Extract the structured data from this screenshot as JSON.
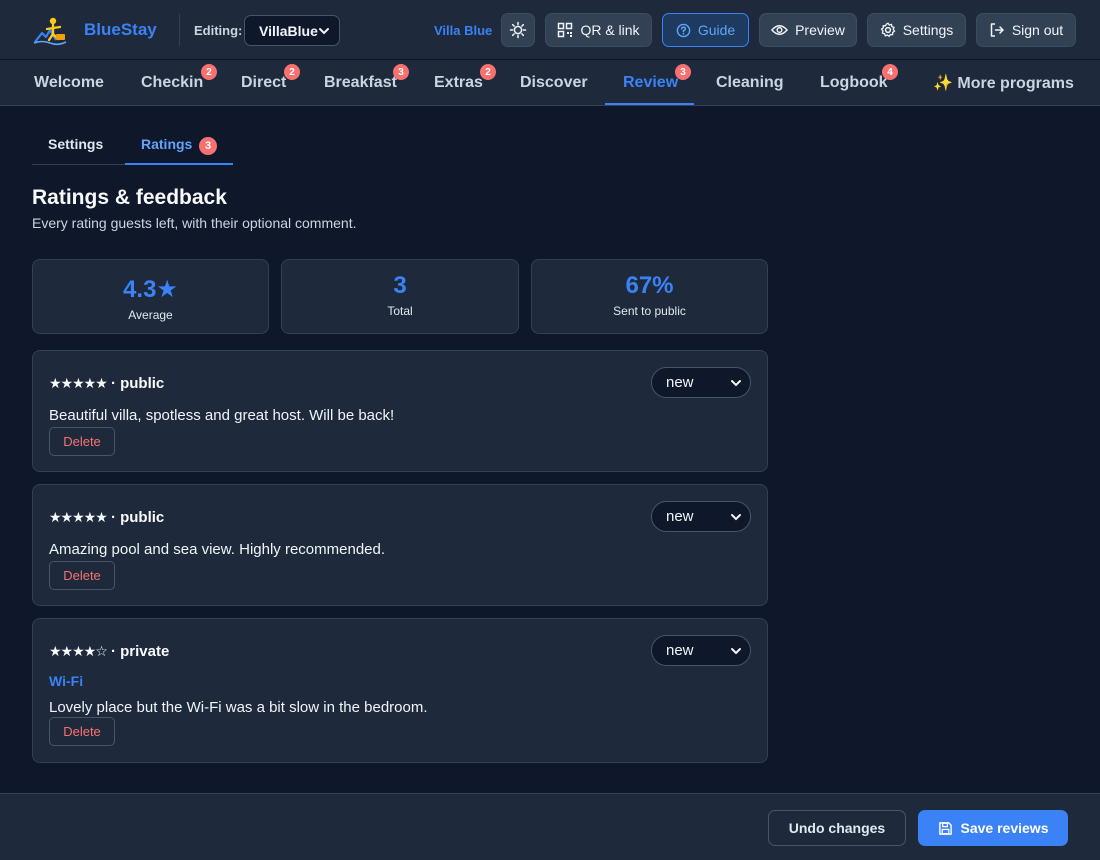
{
  "header": {
    "brand": "BlueStay",
    "editing_label": "Editing:",
    "editing_value": "VillaBlue",
    "villa_name": "Villa Blue",
    "buttons": {
      "qr": "QR & link",
      "guide": "Guide",
      "preview": "Preview",
      "settings": "Settings",
      "signout": "Sign out"
    },
    "icons": [
      "sun-icon",
      "qr-icon",
      "help-circle-icon",
      "eye-icon",
      "gear-icon",
      "logout-icon"
    ]
  },
  "nav": {
    "active": "Review",
    "tabs": [
      {
        "label": "Welcome",
        "badge": ""
      },
      {
        "label": "Checkin",
        "badge": "2"
      },
      {
        "label": "Direct",
        "badge": "2"
      },
      {
        "label": "Breakfast",
        "badge": "3"
      },
      {
        "label": "Extras",
        "badge": "2"
      },
      {
        "label": "Discover",
        "badge": ""
      },
      {
        "label": "Review",
        "badge": "3"
      },
      {
        "label": "Cleaning",
        "badge": ""
      },
      {
        "label": "Logbook",
        "badge": "4"
      },
      {
        "label": "✨ More programs",
        "badge": ""
      }
    ]
  },
  "subtabs": {
    "settings": "Settings",
    "ratings": "Ratings",
    "ratings_badge": "3",
    "active": "Ratings"
  },
  "page": {
    "title": "Ratings & feedback",
    "subtitle": "Every rating guests left, with their optional comment."
  },
  "stats": [
    {
      "value": "4.3★",
      "label": "Average"
    },
    {
      "value": "3",
      "label": "Total"
    },
    {
      "value": "67%",
      "label": "Sent to public"
    }
  ],
  "reviews": [
    {
      "stars": "★★★★★",
      "visibility": "· public",
      "topic": "",
      "comment": "Beautiful villa, spotless and great host. Will be back!",
      "status": "new",
      "delete_label": "Delete"
    },
    {
      "stars": "★★★★★",
      "visibility": "· public",
      "topic": "",
      "comment": "Amazing pool and sea view. Highly recommended.",
      "status": "new",
      "delete_label": "Delete"
    },
    {
      "stars": "★★★★☆",
      "visibility": "· private",
      "topic": "Wi-Fi",
      "comment": "Lovely place but the Wi-Fi was a bit slow in the bedroom.",
      "status": "new",
      "delete_label": "Delete"
    }
  ],
  "footer": {
    "undo": "Undo changes",
    "save": "Save reviews"
  },
  "colors": {
    "accent": "#3b82f6",
    "badge": "#f87171",
    "background": "#0f172a",
    "panel": "#1e293b"
  }
}
